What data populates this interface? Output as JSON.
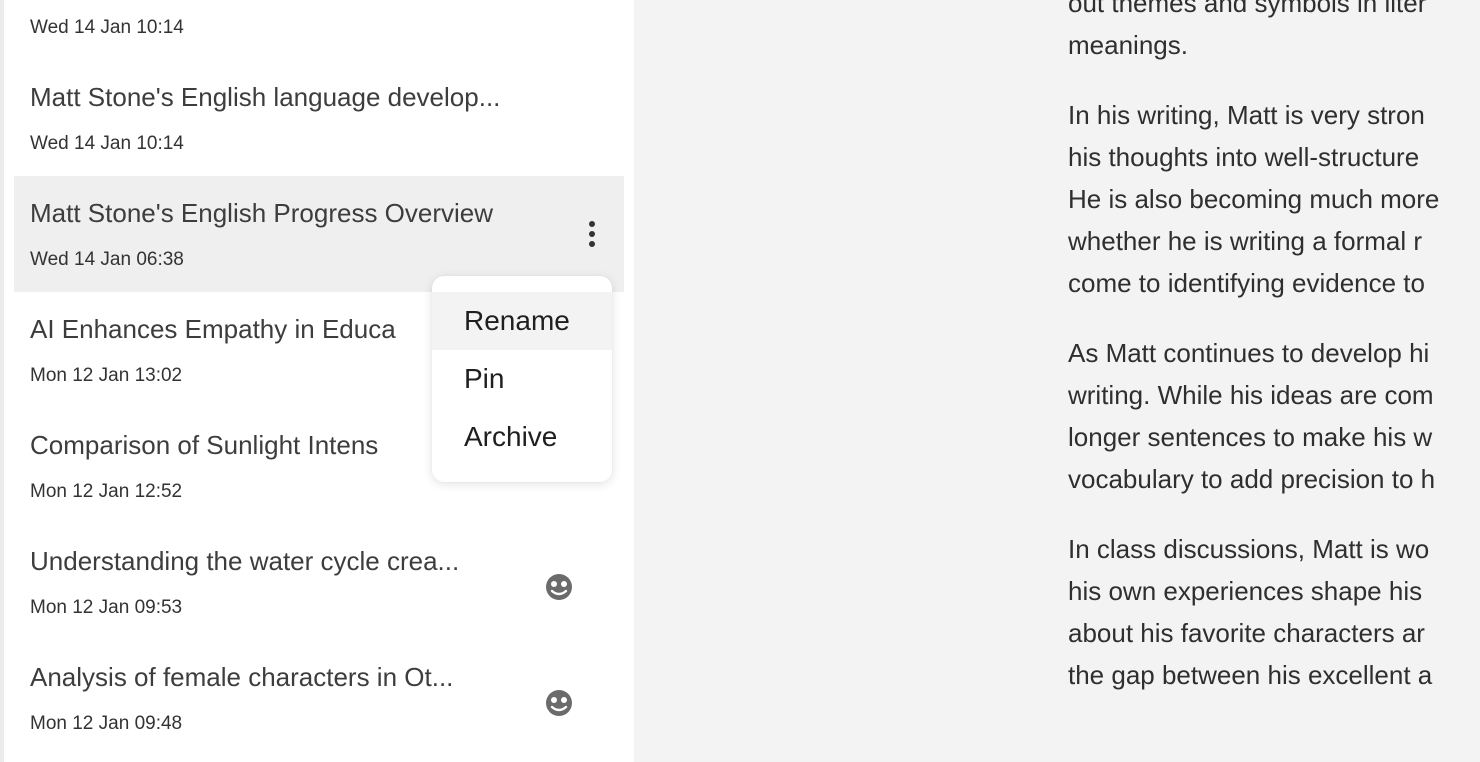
{
  "sidebar": {
    "items": [
      {
        "title": "",
        "date": "Wed 14 Jan 10:14"
      },
      {
        "title": "Matt Stone's English language develop...",
        "date": "Wed 14 Jan 10:14"
      },
      {
        "title": "Matt Stone's English Progress Overview",
        "date": "Wed 14 Jan 06:38"
      },
      {
        "title": "AI Enhances Empathy in Educa",
        "date": "Mon 12 Jan 13:02"
      },
      {
        "title": "Comparison of Sunlight Intens",
        "date": "Mon 12 Jan 12:52"
      },
      {
        "title": "Understanding the water cycle crea...",
        "date": "Mon 12 Jan 09:53",
        "icon": "shared-face-icon"
      },
      {
        "title": "Analysis of female characters in Ot...",
        "date": "Mon 12 Jan 09:48",
        "icon": "shared-face-icon"
      }
    ]
  },
  "context_menu": {
    "items": [
      "Rename",
      "Pin",
      "Archive"
    ]
  },
  "content": {
    "paragraphs": [
      [
        "out themes and symbols in liter",
        "meanings."
      ],
      [
        "In his writing, Matt is very stron",
        "his thoughts into well-structure",
        "He is also becoming much more",
        "whether he is writing a formal r",
        "come to identifying evidence to"
      ],
      [
        "As Matt continues to develop hi",
        "writing. While his ideas are com",
        "longer sentences to make his w",
        "vocabulary to add precision to h"
      ],
      [
        "In class discussions, Matt is wo",
        "his own experiences shape his",
        "about his favorite characters ar",
        "the gap between his excellent a"
      ]
    ]
  },
  "colors": {
    "background": "#f3f3f3",
    "sidebar": "#ffffff",
    "active_item": "#efefef",
    "menu_hover": "#f3f3f3"
  }
}
